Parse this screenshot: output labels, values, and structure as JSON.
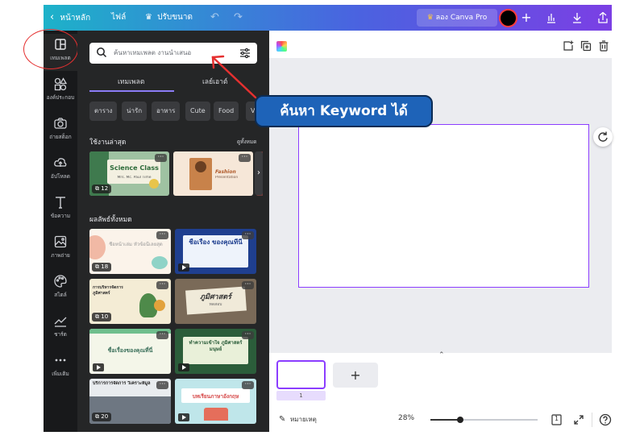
{
  "topbar": {
    "back_label": "หน้าหลัก",
    "file_label": "ไฟล์",
    "resize_label": "ปรับขนาด",
    "try_pro_label": "ลอง Canva Pro",
    "plus": "+",
    "crown_color": "#ffc83d"
  },
  "rail": {
    "items": [
      {
        "label": "เทมเพลต",
        "icon": "template-icon"
      },
      {
        "label": "องค์ประกอบ",
        "icon": "elements-icon"
      },
      {
        "label": "ถ่ายสต็อก",
        "icon": "camera-icon"
      },
      {
        "label": "อัปโหลด",
        "icon": "upload-icon"
      },
      {
        "label": "ข้อความ",
        "icon": "text-icon"
      },
      {
        "label": "ภาพถ่าย",
        "icon": "photo-icon"
      },
      {
        "label": "สไตล์",
        "icon": "palette-icon"
      },
      {
        "label": "ชาร์ต",
        "icon": "chart-icon"
      },
      {
        "label": "เพิ่มเติม",
        "icon": "more-icon"
      }
    ]
  },
  "panel": {
    "search_placeholder": "ค้นหาเทมเพลต งานนำเสนอ",
    "tabs": [
      "เทมเพลต",
      "เลย์เอาต์"
    ],
    "chips": [
      "ตาราง",
      "น่ารัก",
      "อาหาร",
      "Cute",
      "Food",
      "V"
    ],
    "recent_title": "ใช้งานล่าสุด",
    "see_all": "ดูทั้งหมด",
    "recent": [
      {
        "title": "Science Class",
        "subtitle": "Mrs. Mc. Paul Time",
        "badge": "12"
      },
      {
        "title": "Fashion",
        "subtitle": "Presentation"
      }
    ],
    "results_title": "ผลลัพธ์ทั้งหมด",
    "results": [
      {
        "title": "ชื่อหน้าเล่ม หัวข้อนี่เลยสุด",
        "badge": "18"
      },
      {
        "title": "ชื่อเรื่อง ของคุณที่นี่"
      },
      {
        "title": "การบริหารจัดการ ภูมิศาสตร์",
        "badge": "10"
      },
      {
        "title": "ภูมิศาสตร์",
        "subtitle": "ทดสอบ"
      },
      {
        "title": "ชื่อเรื่องของคุณที่นี่"
      },
      {
        "title": "ทำความเข้าใจ ภูมิศาสตร์มนุษย์"
      },
      {
        "title": "บริการการจัดการ วิเคราะห์มูล",
        "badge": "20"
      },
      {
        "title": "บทเรียนภาษาอังกฤษ"
      }
    ]
  },
  "callout": {
    "text": "ค้นหา Keyword ได้"
  },
  "footer": {
    "page_number": "1",
    "add_page": "+",
    "notes_label": "หมายเหตุ",
    "zoom_label": "28%",
    "zoom_value": 0.28,
    "page_count": "1"
  },
  "colors": {
    "accent": "#8b3dff",
    "panel_bg": "#252627",
    "rail_bg": "#18191b",
    "callout_bg": "#1e63b8",
    "annotation_red": "#e53030"
  }
}
